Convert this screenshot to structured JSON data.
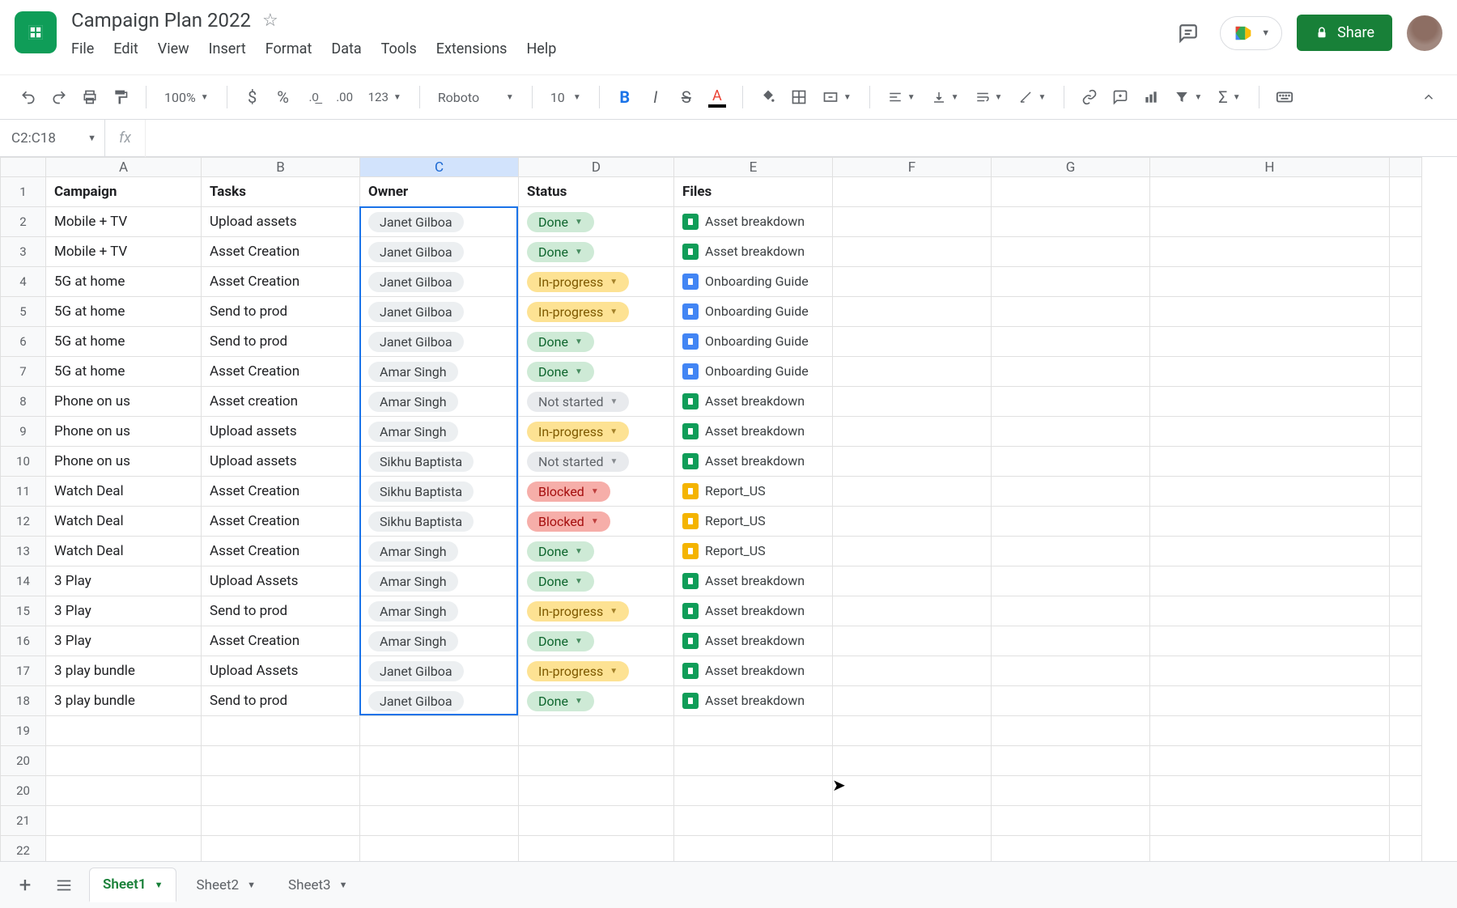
{
  "header": {
    "title": "Campaign Plan 2022",
    "menus": [
      "File",
      "Edit",
      "View",
      "Insert",
      "Format",
      "Data",
      "Tools",
      "Extensions",
      "Help"
    ],
    "share_label": "Share"
  },
  "toolbar": {
    "zoom": "100%",
    "font": "Roboto",
    "font_size": "10"
  },
  "name_box": "C2:C18",
  "columns": [
    "A",
    "B",
    "C",
    "D",
    "E",
    "F",
    "G",
    "H"
  ],
  "headers": {
    "A": "Campaign",
    "B": "Tasks",
    "C": "Owner",
    "D": "Status",
    "E": "Files"
  },
  "status_styles": {
    "Done": "s-done",
    "In-progress": "s-inprogress",
    "Not started": "s-notstarted",
    "Blocked": "s-blocked"
  },
  "file_styles": {
    "Asset breakdown": "fi-sheets",
    "Onboarding Guide": "fi-docs",
    "Report_US": "fi-slides"
  },
  "rows": [
    {
      "n": 2,
      "campaign": "Mobile + TV",
      "task": "Upload assets",
      "owner": "Janet Gilboa",
      "status": "Done",
      "file": "Asset breakdown"
    },
    {
      "n": 3,
      "campaign": "Mobile + TV",
      "task": "Asset Creation",
      "owner": "Janet Gilboa",
      "status": "Done",
      "file": "Asset breakdown"
    },
    {
      "n": 4,
      "campaign": "5G at home",
      "task": "Asset Creation",
      "owner": "Janet Gilboa",
      "status": "In-progress",
      "file": "Onboarding Guide"
    },
    {
      "n": 5,
      "campaign": "5G at home",
      "task": "Send to prod",
      "owner": "Janet Gilboa",
      "status": "In-progress",
      "file": "Onboarding Guide"
    },
    {
      "n": 6,
      "campaign": "5G at home",
      "task": "Send to prod",
      "owner": "Janet Gilboa",
      "status": "Done",
      "file": "Onboarding Guide"
    },
    {
      "n": 7,
      "campaign": "5G at home",
      "task": "Asset Creation",
      "owner": "Amar Singh",
      "status": "Done",
      "file": "Onboarding Guide"
    },
    {
      "n": 8,
      "campaign": "Phone on us",
      "task": "Asset creation",
      "owner": "Amar Singh",
      "status": "Not started",
      "file": "Asset breakdown"
    },
    {
      "n": 9,
      "campaign": "Phone on us",
      "task": "Upload assets",
      "owner": "Amar Singh",
      "status": "In-progress",
      "file": "Asset breakdown"
    },
    {
      "n": 10,
      "campaign": "Phone on us",
      "task": "Upload assets",
      "owner": "Sikhu Baptista",
      "status": "Not started",
      "file": "Asset breakdown"
    },
    {
      "n": 11,
      "campaign": "Watch Deal",
      "task": "Asset Creation",
      "owner": "Sikhu Baptista",
      "status": "Blocked",
      "file": "Report_US"
    },
    {
      "n": 12,
      "campaign": "Watch Deal",
      "task": "Asset Creation",
      "owner": "Sikhu Baptista",
      "status": "Blocked",
      "file": "Report_US"
    },
    {
      "n": 13,
      "campaign": "Watch Deal",
      "task": "Asset Creation",
      "owner": "Amar Singh",
      "status": "Done",
      "file": "Report_US"
    },
    {
      "n": 14,
      "campaign": "3 Play",
      "task": "Upload Assets",
      "owner": "Amar Singh",
      "status": "Done",
      "file": "Asset breakdown"
    },
    {
      "n": 15,
      "campaign": "3 Play",
      "task": "Send to prod",
      "owner": "Amar Singh",
      "status": "In-progress",
      "file": "Asset breakdown"
    },
    {
      "n": 16,
      "campaign": "3 Play",
      "task": "Asset Creation",
      "owner": "Amar Singh",
      "status": "Done",
      "file": "Asset breakdown"
    },
    {
      "n": 17,
      "campaign": "3 play bundle",
      "task": "Upload Assets",
      "owner": "Janet Gilboa",
      "status": "In-progress",
      "file": "Asset breakdown"
    },
    {
      "n": 18,
      "campaign": "3 play bundle",
      "task": "Send to prod",
      "owner": "Janet Gilboa",
      "status": "Done",
      "file": "Asset breakdown"
    }
  ],
  "empty_rows": [
    19,
    20,
    20,
    21,
    22
  ],
  "sheets": [
    "Sheet1",
    "Sheet2",
    "Sheet3"
  ],
  "active_sheet": 0
}
